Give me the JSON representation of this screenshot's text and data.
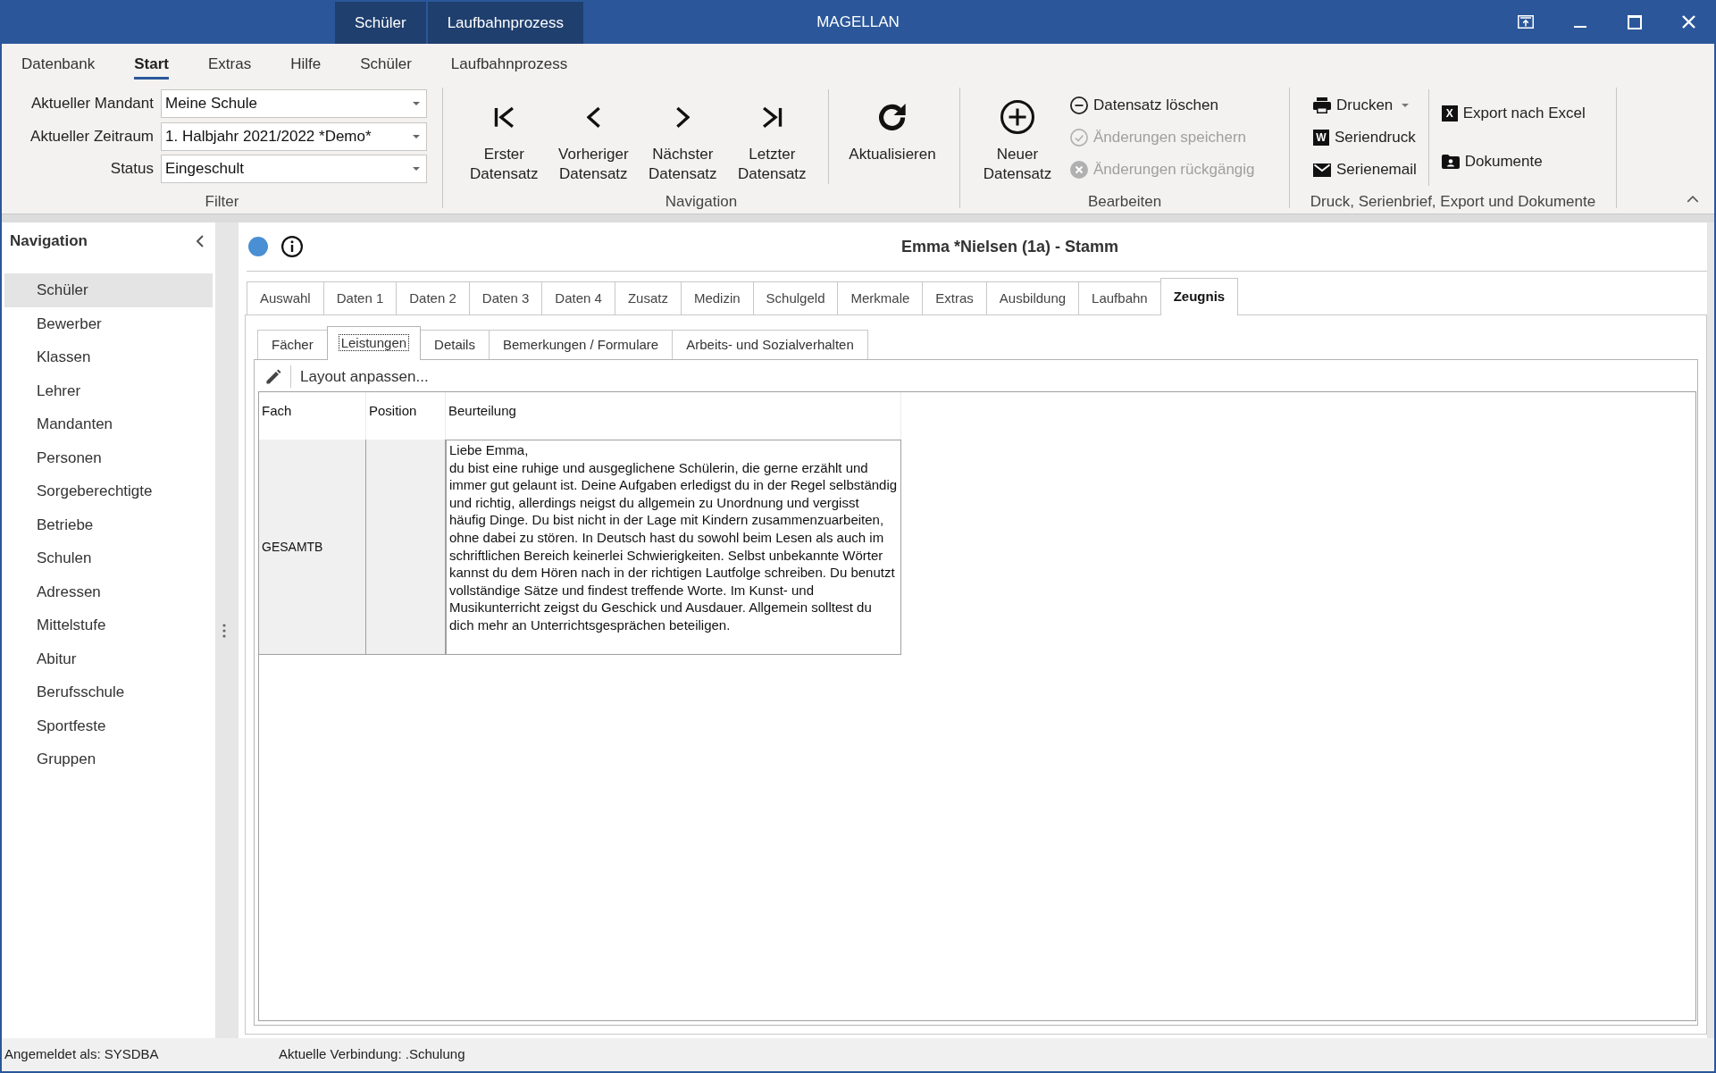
{
  "window": {
    "context_tabs": [
      {
        "label": "Schüler"
      },
      {
        "label": "Laufbahnprozess"
      }
    ],
    "title": "MAGELLAN"
  },
  "ribbon": {
    "menu": [
      {
        "label": "Datenbank",
        "selected": false
      },
      {
        "label": "Start",
        "selected": true
      },
      {
        "label": "Extras",
        "selected": false
      },
      {
        "label": "Hilfe",
        "selected": false
      },
      {
        "label": "Schüler",
        "selected": false
      },
      {
        "label": "Laufbahnprozess",
        "selected": false
      }
    ],
    "groups": [
      {
        "label": "Filter",
        "sections": [
          {
            "kind": "fields",
            "separated": false,
            "items": [
              {
                "label": "Aktueller Mandant",
                "value": "Meine Schule"
              },
              {
                "label": "Aktueller Zeitraum",
                "value": "1. Halbjahr 2021/2022 *Demo*"
              },
              {
                "label": "Status",
                "value": "Eingeschult"
              }
            ]
          }
        ]
      },
      {
        "label": "Navigation",
        "sections": [
          {
            "kind": "large",
            "separated": false,
            "items": [
              {
                "label": "Erster Datensatz",
                "disabled": false
              },
              {
                "label": "Vorheriger Datensatz",
                "disabled": false
              },
              {
                "label": "Nächster Datensatz",
                "disabled": false
              },
              {
                "label": "Letzter Datensatz",
                "disabled": false
              }
            ]
          },
          {
            "kind": "large",
            "separated": true,
            "items": [
              {
                "label": "Aktualisieren",
                "disabled": false
              }
            ]
          }
        ]
      },
      {
        "label": "Bearbeiten",
        "sections": [
          {
            "kind": "large",
            "separated": false,
            "items": [
              {
                "label": "Neuer Datensatz",
                "disabled": false
              }
            ]
          },
          {
            "kind": "small",
            "separated": false,
            "items": [
              {
                "label": "Datensatz löschen",
                "disabled": false
              },
              {
                "label": "Änderungen speichern",
                "disabled": true
              },
              {
                "label": "Änderungen rückgängig",
                "disabled": true
              }
            ]
          }
        ]
      },
      {
        "label": "Druck, Serienbrief, Export und Dokumente",
        "sections": [
          {
            "kind": "small",
            "separated": false,
            "items": [
              {
                "label": "Drucken",
                "disabled": false,
                "dropdown": true
              },
              {
                "label": "Seriendruck",
                "disabled": false,
                "dropdown": false,
                "tile": "W"
              },
              {
                "label": "Serienemail",
                "disabled": false,
                "dropdown": false
              }
            ]
          },
          {
            "kind": "small",
            "separated": true,
            "items": [
              {
                "label": "Export nach Excel",
                "disabled": false,
                "tile": "X"
              },
              {
                "label": "Dokumente",
                "disabled": false
              }
            ]
          }
        ]
      }
    ]
  },
  "sidebar": {
    "title": "Navigation",
    "items": [
      {
        "label": "Schüler",
        "selected": true
      },
      {
        "label": "Bewerber",
        "selected": false
      },
      {
        "label": "Klassen",
        "selected": false
      },
      {
        "label": "Lehrer",
        "selected": false
      },
      {
        "label": "Mandanten",
        "selected": false
      },
      {
        "label": "Personen",
        "selected": false
      },
      {
        "label": "Sorgeberechtigte",
        "selected": false
      },
      {
        "label": "Betriebe",
        "selected": false
      },
      {
        "label": "Schulen",
        "selected": false
      },
      {
        "label": "Adressen",
        "selected": false
      },
      {
        "label": "Mittelstufe",
        "selected": false
      },
      {
        "label": "Abitur",
        "selected": false
      },
      {
        "label": "Berufsschule",
        "selected": false
      },
      {
        "label": "Sportfeste",
        "selected": false
      },
      {
        "label": "Gruppen",
        "selected": false
      }
    ]
  },
  "record": {
    "title": "Emma *Nielsen (1a) - Stamm",
    "tabs": [
      {
        "label": "Auswahl",
        "selected": false
      },
      {
        "label": "Daten 1",
        "selected": false
      },
      {
        "label": "Daten 2",
        "selected": false
      },
      {
        "label": "Daten 3",
        "selected": false
      },
      {
        "label": "Daten 4",
        "selected": false
      },
      {
        "label": "Zusatz",
        "selected": false
      },
      {
        "label": "Medizin",
        "selected": false
      },
      {
        "label": "Schulgeld",
        "selected": false
      },
      {
        "label": "Merkmale",
        "selected": false
      },
      {
        "label": "Extras",
        "selected": false
      },
      {
        "label": "Ausbildung",
        "selected": false
      },
      {
        "label": "Laufbahn",
        "selected": false
      },
      {
        "label": "Zeugnis",
        "selected": true
      }
    ],
    "subtabs": [
      {
        "label": "Fächer",
        "selected": false
      },
      {
        "label": "Leistungen",
        "selected": true
      },
      {
        "label": "Details",
        "selected": false
      },
      {
        "label": "Bemerkungen / Formulare",
        "selected": false
      },
      {
        "label": "Arbeits- und Sozialverhalten",
        "selected": false
      }
    ],
    "toolbar": {
      "label": "Layout anpassen..."
    },
    "grid": {
      "columns": [
        "Fach",
        "Position",
        "Beurteilung"
      ],
      "rows": [
        {
          "cells": [
            "GESAMTB",
            null,
            "Liebe Emma,\ndu bist eine ruhige und ausgeglichene Schülerin, die gerne erzählt und immer gut gelaunt ist. Deine Aufgaben erledigst du in der Regel selbständig und richtig, allerdings neigst du allgemein zu Unordnung und vergisst häufig Dinge. Du bist nicht in der Lage mit Kindern zusammenzuarbeiten, ohne dabei zu stören. In Deutsch hast du sowohl beim Lesen als auch im schriftlichen Bereich keinerlei Schwierigkeiten. Selbst unbekannte Wörter kannst du dem Hören nach in der richtigen Lautfolge schreiben. Du benutzt vollständige Sätze und findest treffende Worte. Im Kunst- und Musikunterricht zeigst du Geschick und Ausdauer. Allgemein solltest du dich mehr an Unterrichtsgesprächen beteiligen."
          ]
        }
      ]
    }
  },
  "status_bar": {
    "items": [
      "Angemeldet als: SYSDBA",
      "Aktuelle Verbindung: .Schulung"
    ]
  }
}
